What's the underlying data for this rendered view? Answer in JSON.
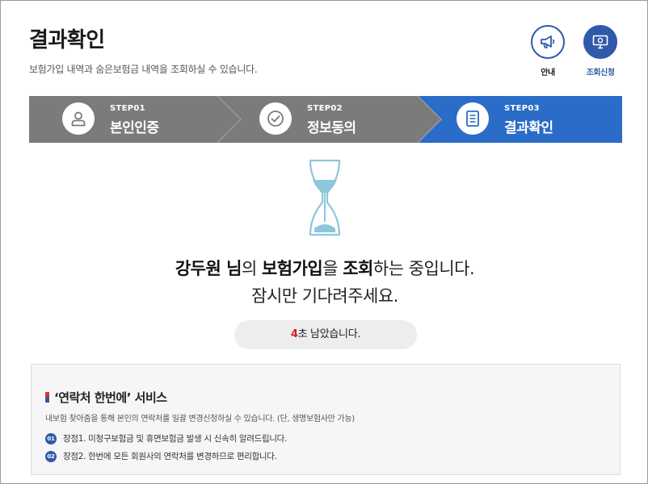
{
  "page": {
    "title": "결과확인",
    "subtitle": "보험가입 내역과 숨은보험금 내역을 조회하실 수 있습니다."
  },
  "top_buttons": {
    "guide_label": "안내",
    "apply_label": "조회신청"
  },
  "steps": [
    {
      "number": "STEP01",
      "label": "본인인증",
      "icon": "user-icon",
      "active": false
    },
    {
      "number": "STEP02",
      "label": "정보동의",
      "icon": "check-circle-icon",
      "active": false
    },
    {
      "number": "STEP03",
      "label": "결과확인",
      "icon": "document-icon",
      "active": true
    }
  ],
  "progress": {
    "name": "강두원",
    "name_suffix": " 님",
    "particle1": "의 ",
    "item": "보험가입",
    "particle2": "을 ",
    "action": "조회",
    "rest": "하는 중입니다.",
    "wait_message": "잠시만 기다려주세요."
  },
  "timer": {
    "seconds": "4",
    "text": "초 남았습니다."
  },
  "service": {
    "title": "‘연락처 한번에’ 서비스",
    "description": "내보험 찾아줌을 통해 본인의 연락처를 일괄 변경신청하실 수 있습니다. (단, 생명보험사만 가능)",
    "items": [
      {
        "badge": "01",
        "text": "장점1. 미청구보험금 및 휴면보험금 발생 시 신속히 알려드립니다."
      },
      {
        "badge": "02",
        "text": "장점2. 한번에 모든 회원사의 연락처를 변경하므로 편리합니다."
      }
    ]
  },
  "colors": {
    "accent": "#2e5aa8",
    "step_active": "#2a6cc7",
    "step_inactive": "#7b7b7b",
    "hourglass_sand": "#8ec6dc",
    "countdown": "#d41f1f"
  }
}
